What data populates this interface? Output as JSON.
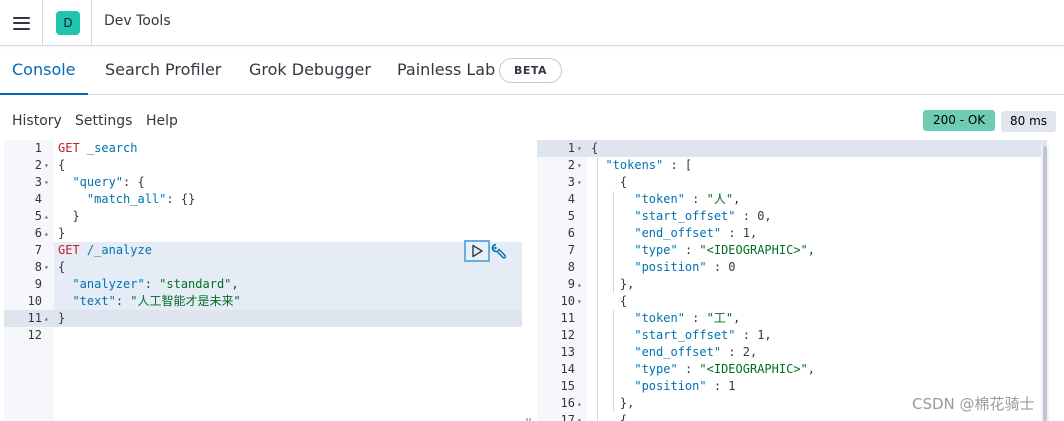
{
  "header": {
    "space_initial": "D",
    "app_title": "Dev Tools",
    "icons": [
      "menu-icon"
    ]
  },
  "tabs": [
    {
      "label": "Console",
      "active": true
    },
    {
      "label": "Search Profiler",
      "active": false
    },
    {
      "label": "Grok Debugger",
      "active": false
    },
    {
      "label": "Painless Lab",
      "active": false,
      "badge": "BETA"
    }
  ],
  "subnav": {
    "items": [
      "History",
      "Settings",
      "Help"
    ],
    "status": "200 - OK",
    "duration": "80 ms",
    "status_color": "#6dccb1"
  },
  "request_editor": {
    "lines": [
      {
        "n": "1",
        "fold": "",
        "text": "GET _search"
      },
      {
        "n": "2",
        "fold": "▾",
        "text": "{"
      },
      {
        "n": "3",
        "fold": "▾",
        "text": "  \"query\": {"
      },
      {
        "n": "4",
        "fold": "",
        "text": "    \"match_all\": {}"
      },
      {
        "n": "5",
        "fold": "▴",
        "text": "  }"
      },
      {
        "n": "6",
        "fold": "▴",
        "text": "}"
      },
      {
        "n": "7",
        "fold": "",
        "text": "GET /_analyze"
      },
      {
        "n": "8",
        "fold": "▾",
        "text": "{"
      },
      {
        "n": "9",
        "fold": "",
        "text": "  \"analyzer\": \"standard\","
      },
      {
        "n": "10",
        "fold": "",
        "text": "  \"text\": \"人工智能才是未来\""
      },
      {
        "n": "11",
        "fold": "▴",
        "text": "}"
      },
      {
        "n": "12",
        "fold": "",
        "text": ""
      }
    ]
  },
  "response_editor": {
    "lines": [
      {
        "n": "1",
        "fold": "▾",
        "text": "{"
      },
      {
        "n": "2",
        "fold": "▾",
        "text": "  \"tokens\" : ["
      },
      {
        "n": "3",
        "fold": "▾",
        "text": "    {"
      },
      {
        "n": "4",
        "fold": "",
        "text": "      \"token\" : \"人\","
      },
      {
        "n": "5",
        "fold": "",
        "text": "      \"start_offset\" : 0,"
      },
      {
        "n": "6",
        "fold": "",
        "text": "      \"end_offset\" : 1,"
      },
      {
        "n": "7",
        "fold": "",
        "text": "      \"type\" : \"<IDEOGRAPHIC>\","
      },
      {
        "n": "8",
        "fold": "",
        "text": "      \"position\" : 0"
      },
      {
        "n": "9",
        "fold": "▴",
        "text": "    },"
      },
      {
        "n": "10",
        "fold": "▾",
        "text": "    {"
      },
      {
        "n": "11",
        "fold": "",
        "text": "      \"token\" : \"工\","
      },
      {
        "n": "12",
        "fold": "",
        "text": "      \"start_offset\" : 1,"
      },
      {
        "n": "13",
        "fold": "",
        "text": "      \"end_offset\" : 2,"
      },
      {
        "n": "14",
        "fold": "",
        "text": "      \"type\" : \"<IDEOGRAPHIC>\","
      },
      {
        "n": "15",
        "fold": "",
        "text": "      \"position\" : 1"
      },
      {
        "n": "16",
        "fold": "▴",
        "text": "    },"
      },
      {
        "n": "17",
        "fold": "▾",
        "text": "    {"
      }
    ]
  },
  "actions": {
    "icons": [
      "play-icon",
      "wrench-icon"
    ]
  },
  "watermark": "CSDN @棉花骑士"
}
